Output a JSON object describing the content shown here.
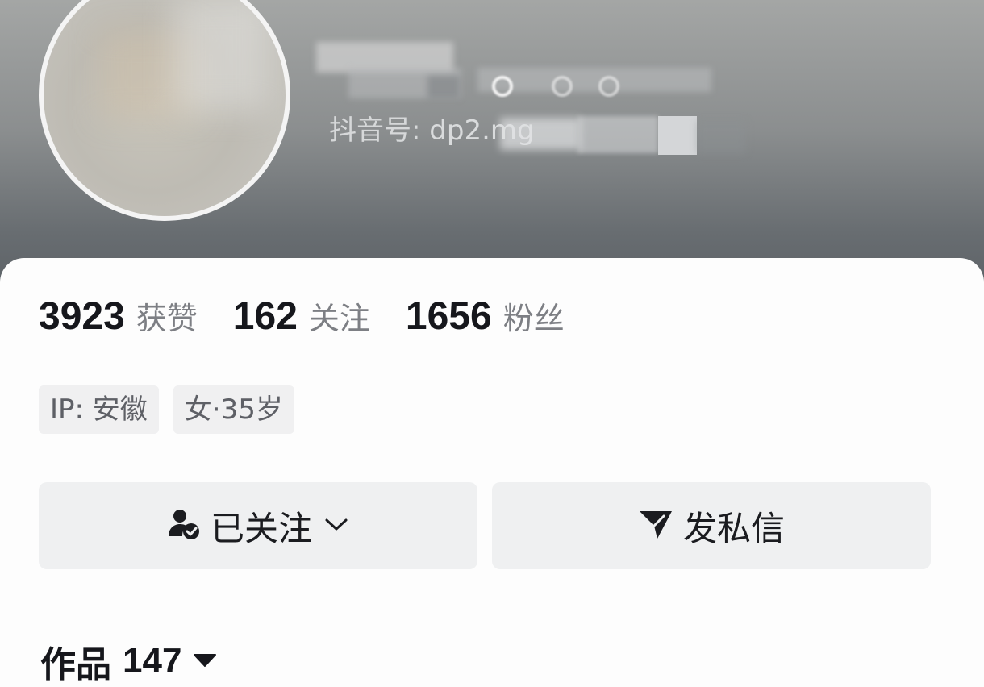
{
  "profile": {
    "douyin_id_label": "抖音号:",
    "douyin_id_visible": "dp2.mg"
  },
  "stats": [
    {
      "number": "3923",
      "label": "获赞"
    },
    {
      "number": "162",
      "label": "关注"
    },
    {
      "number": "1656",
      "label": "粉丝"
    }
  ],
  "tags": [
    {
      "text": "IP: 安徽"
    },
    {
      "text": "女·35岁"
    }
  ],
  "actions": {
    "follow_label": "已关注",
    "message_label": "发私信"
  },
  "works": {
    "label": "作品",
    "count": "147"
  },
  "icons": {
    "follow": "user-check-icon",
    "follow_dropdown": "chevron-down-icon",
    "message": "send-icon",
    "works_dropdown": "caret-down-icon"
  },
  "colors": {
    "header_top": "#a4a6a5",
    "header_bottom": "#5d6267",
    "button_bg": "#eff0f1",
    "text_primary": "#16171c",
    "text_secondary": "#7d7f84"
  }
}
